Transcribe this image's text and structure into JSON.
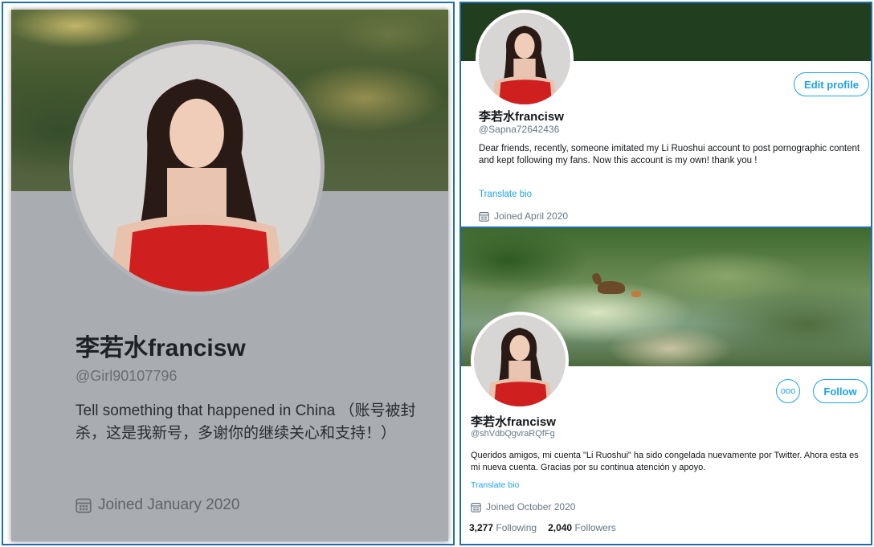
{
  "left_profile": {
    "name": "李若水francisw",
    "handle": "@Girl90107796",
    "bio": "Tell something that happened in China （账号被封杀，这是我新号，多谢你的继续关心和支持！）",
    "joined": "Joined January 2020",
    "joined_icon": "calendar-icon"
  },
  "top_right_profile": {
    "name": "李若水francisw",
    "handle": "@Sapna72642436",
    "edit_button": "Edit profile",
    "bio": "Dear friends, recently, someone  imitated my Li Ruoshui account to post pornographic content and kept following my fans. Now this account is my own! thank you !",
    "translate": "Translate bio",
    "joined": "Joined April 2020",
    "joined_icon": "calendar-icon"
  },
  "bottom_right_profile": {
    "name": "李若水francisw",
    "handle": "@shVdbQgvraRQfFg",
    "more_button": "ooo",
    "follow_button": "Follow",
    "bio": "Queridos amigos, mi cuenta \"Li Ruoshui\" ha sido congelada nuevamente por Twitter. Ahora esta es mi nueva cuenta. Gracias por su continua atención y apoyo.",
    "translate": "Translate bio",
    "joined": "Joined October 2020",
    "joined_icon": "calendar-icon",
    "following_count": "3,277",
    "following_label": "Following",
    "followers_count": "2,040",
    "followers_label": "Followers"
  },
  "colors": {
    "frame_border": "#1f6fb0",
    "twitter_blue": "#1da1f2",
    "dress_red": "#d01f1f",
    "dark_green_banner": "#213e1f"
  }
}
